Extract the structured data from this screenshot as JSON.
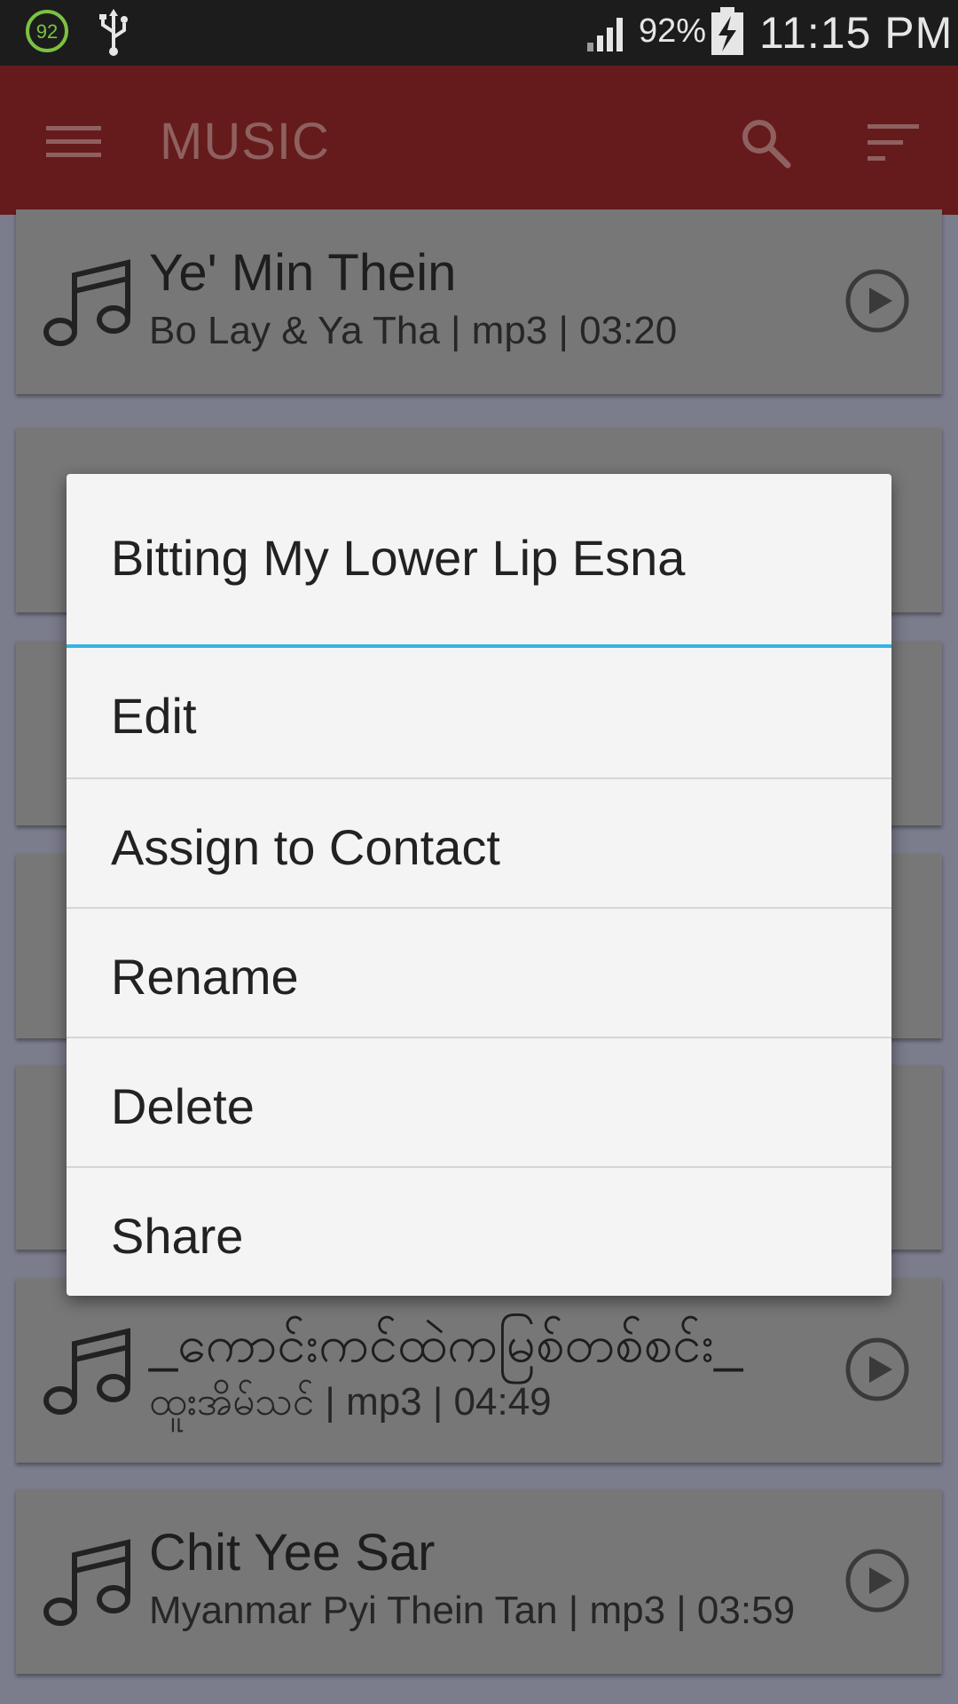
{
  "status_bar": {
    "badge": "92",
    "battery": "92%",
    "time": "11:15 PM"
  },
  "app_bar": {
    "title": "MUSIC",
    "icons": [
      "menu-icon",
      "search-icon",
      "sort-icon"
    ]
  },
  "songs": [
    {
      "title": "Ye' Min Thein",
      "subtitle": "Bo Lay & Ya Tha | mp3 | 03:20"
    },
    {
      "title": "_ကောင်းကင်ထဲကမြစ်တစ်စင်း_",
      "subtitle": "ထူးအိမ်သင် | mp3 | 04:49"
    },
    {
      "title": "Chit Yee Sar",
      "subtitle": "Myanmar Pyi Thein Tan | mp3 | 03:59"
    }
  ],
  "dialog": {
    "title": "Bitting My Lower Lip Esna",
    "items": [
      "Edit",
      "Assign to Contact",
      "Rename",
      "Delete",
      "Share"
    ]
  },
  "colors": {
    "app_bar": "#651b1b",
    "dialog_accent": "#33b5e5",
    "scrim_background": "#7b7c8c"
  }
}
